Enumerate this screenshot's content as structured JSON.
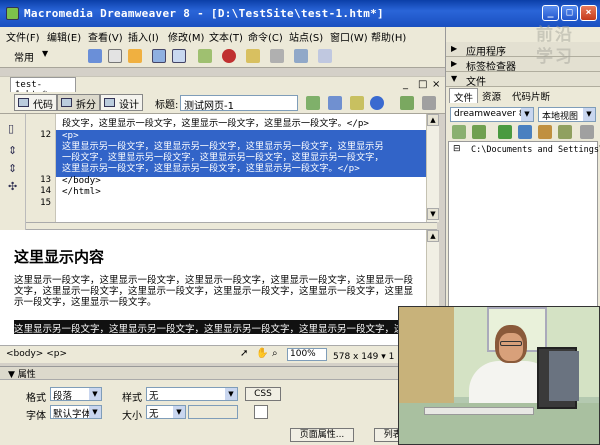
{
  "window": {
    "title": "Macromedia Dreamweaver 8 - [D:\\TestSite\\test-1.htm*]",
    "min": "_",
    "max": "□",
    "close": "×"
  },
  "menu": [
    "文件(F)",
    "编辑(E)",
    "查看(V)",
    "插入(I)",
    "修改(M)",
    "文本(T)",
    "命令(C)",
    "站点(S)",
    "窗口(W)",
    "帮助(H)"
  ],
  "insert_toolbar": {
    "category": "常用",
    "arrow": "▼"
  },
  "document": {
    "tab": "test-1.htm*",
    "view_code": "代码",
    "view_split": "拆分",
    "view_design": "设计",
    "title_label": "标题:",
    "title_value": "测试网页-1"
  },
  "code": {
    "lines": [
      {
        "num": "",
        "text": "段文字，这里显示一段文字，这里显示一段文字，这里显示一段文字。</p>"
      },
      {
        "num": "12",
        "text": "<p>"
      },
      {
        "num": "",
        "text": "这里显示另一段文字，这里显示另一段文字，这里显示另一段文字，这里显示另"
      },
      {
        "num": "",
        "text": "一段文字，这里显示另一段文字，这里显示另一段文字，这里显示另一段文字，"
      },
      {
        "num": "",
        "text": "这里显示另一段文字，这里显示另一段文字，这里显示另一段文字。</p>"
      },
      {
        "num": "13",
        "text": "</body>"
      },
      {
        "num": "14",
        "text": "</html>"
      },
      {
        "num": "15",
        "text": ""
      }
    ]
  },
  "design": {
    "heading": "这里显示内容",
    "para1": "这里显示一段文字，这里显示一段文字，这里显示一段文字，这里显示一段文字，这里显示一段文字，这里显示一段文字，这里显示一段文字，这里显示一段文字，这里显示一段文字，这里显示一段文字，这里显示一段文字。",
    "para2": "这里显示另一段文字，这里显示另一段文字，这里显示另一段文字，这里显示另一段文字，这里显示另一段文字"
  },
  "status": {
    "tags": "<body> <p>",
    "zoom": "100%",
    "size": "578 x 149 ▾ 1 K / 1 秒"
  },
  "properties": {
    "header": "▼ 属性",
    "format_label": "格式",
    "format_value": "段落",
    "style_label": "样式",
    "style_value": "无",
    "css_button": "CSS",
    "font_label": "字体",
    "font_value": "默认字体",
    "size_label": "大小",
    "size_value": "无",
    "page_props_button": "页面属性...",
    "list_item_button": "列表项目..."
  },
  "right_panel": {
    "groups": [
      "应用程序",
      "标签检查器",
      "文件"
    ],
    "tabs": [
      "文件",
      "资源",
      "代码片断"
    ],
    "site": "dreamweaver 8",
    "view": "本地视图",
    "path": "C:\\Documents and Settings\\new\\"
  },
  "watermark": "前沿学习"
}
